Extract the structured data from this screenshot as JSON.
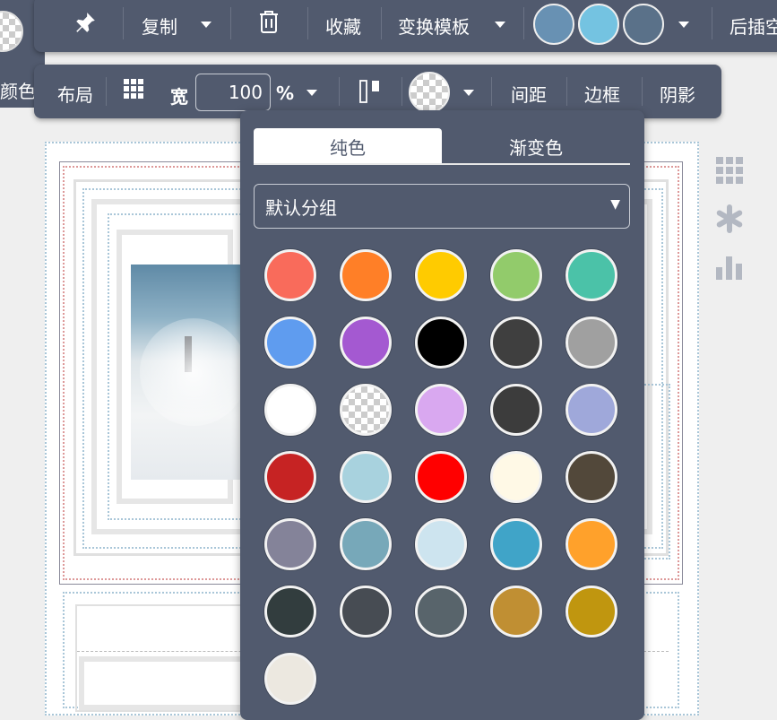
{
  "left_panel": {
    "label": "颜色"
  },
  "toolbar_top": {
    "copy_label": "复制",
    "favorite_label": "收藏",
    "template_label": "变换模板",
    "after_insert_label": "后插空",
    "preset_colors": [
      "#6891b3",
      "#74c3e1",
      "#5a7189"
    ]
  },
  "toolbar_second": {
    "layout_label": "布局",
    "width_label": "宽",
    "width_value": "100",
    "width_unit": "%",
    "spacing_label": "间距",
    "border_label": "边框",
    "shadow_label": "阴影"
  },
  "color_picker": {
    "tabs": [
      "纯色",
      "渐变色"
    ],
    "active_tab": "纯色",
    "group_select": "默认分组",
    "swatches": [
      "#f96b5b",
      "#ff7f27",
      "#ffcb00",
      "#92cb6b",
      "#4bc2a8",
      "#5f9cef",
      "#a459d1",
      "#000000",
      "#3f3f3f",
      "#a0a0a0",
      "#ffffff",
      "transparent",
      "#d9a8f0",
      "#3c3c3c",
      "#9fa8da",
      "#c62323",
      "#a8d2de",
      "#ff0000",
      "#fff9e6",
      "#52483a",
      "#848399",
      "#77a8b9",
      "#cde4ef",
      "#40a4c8",
      "#ffa12b",
      "#323d3e",
      "#474c53",
      "#58646b",
      "#c08f33",
      "#c0960f",
      "#ece8e0"
    ]
  }
}
